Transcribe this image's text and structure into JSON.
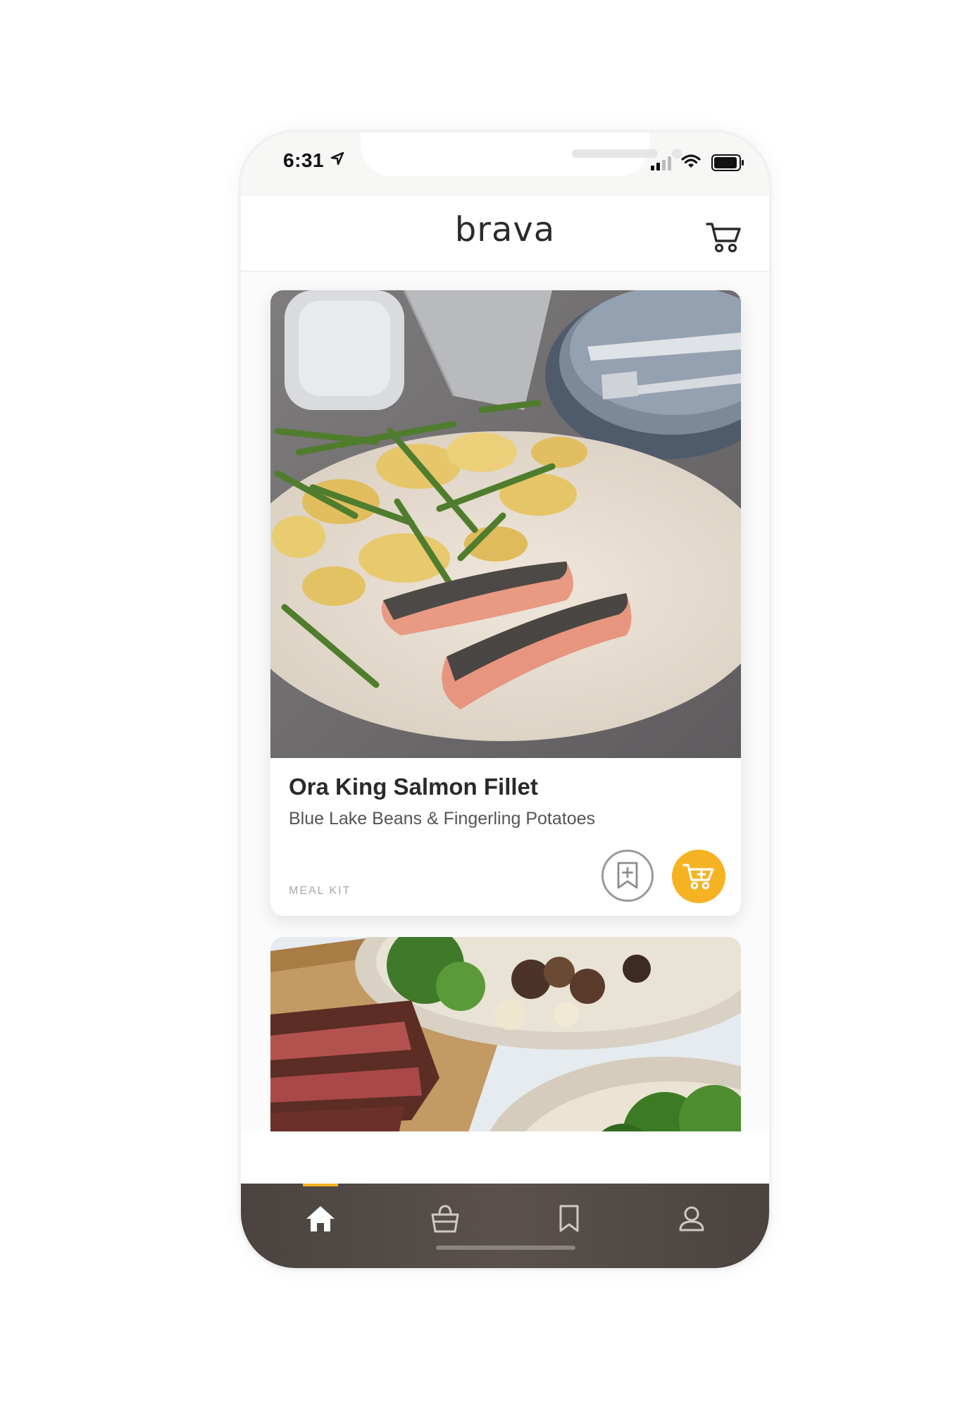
{
  "status_bar": {
    "time": "6:31"
  },
  "header": {
    "brand": "brava",
    "cart_icon": "cart-icon"
  },
  "products": [
    {
      "title": "Ora King Salmon Fillet",
      "subtitle": "Blue Lake Beans & Fingerling Potatoes",
      "type_label": "MEAL KIT",
      "bookmark_icon": "bookmark-add-icon",
      "cart_icon": "cart-add-icon"
    }
  ],
  "tab_bar": {
    "tabs": [
      {
        "icon": "home-icon",
        "active": true
      },
      {
        "icon": "shopping-bag-icon",
        "active": false
      },
      {
        "icon": "bookmark-icon",
        "active": false
      },
      {
        "icon": "profile-icon",
        "active": false
      }
    ]
  },
  "colors": {
    "accent": "#f5b323",
    "tab_bar": "#4d4541",
    "title_text": "#2a2a2a"
  }
}
